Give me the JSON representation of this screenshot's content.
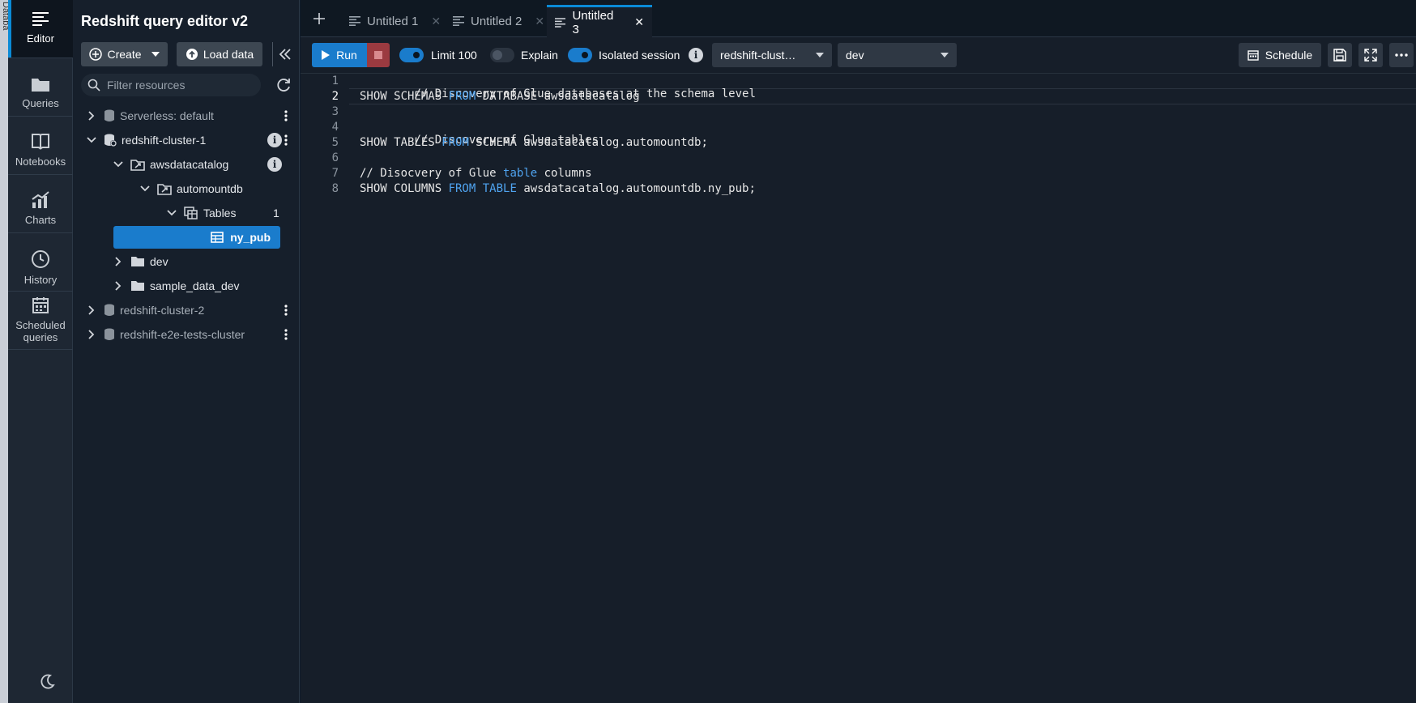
{
  "edge": {
    "label": "Databa"
  },
  "rail": {
    "items": [
      {
        "label": "Editor",
        "icon": "editor-icon"
      },
      {
        "label": "Queries",
        "icon": "folder-icon"
      },
      {
        "label": "Notebooks",
        "icon": "book-icon"
      },
      {
        "label": "Charts",
        "icon": "chart-icon"
      },
      {
        "label": "History",
        "icon": "clock-icon"
      },
      {
        "label_line1": "Scheduled",
        "label_line2": "queries",
        "icon": "calendar-icon"
      }
    ]
  },
  "panel": {
    "title": "Redshift query editor v2",
    "create_label": "Create",
    "load_label": "Load data",
    "filter_placeholder": "Filter resources",
    "tree": {
      "serverless": "Serverless: default",
      "cluster1": "redshift-cluster-1",
      "awsdatacatalog": "awsdatacatalog",
      "automountdb": "automountdb",
      "tables": "Tables",
      "tables_count": "1",
      "ny_pub": "ny_pub",
      "dev": "dev",
      "sample_data_dev": "sample_data_dev",
      "cluster2": "redshift-cluster-2",
      "e2e": "redshift-e2e-tests-cluster"
    }
  },
  "tabs": [
    {
      "label": "Untitled 1",
      "active": false
    },
    {
      "label": "Untitled 2",
      "active": false
    },
    {
      "label": "Untitled 3",
      "active": true
    }
  ],
  "toolbar": {
    "run_label": "Run",
    "limit_label": "Limit 100",
    "limit_on": true,
    "explain_label": "Explain",
    "explain_on": false,
    "isolated_label": "Isolated session",
    "isolated_on": true,
    "cluster_select": "redshift-clust…",
    "db_select": "dev",
    "schedule_label": "Schedule"
  },
  "editor": {
    "current_line": 2,
    "lines": [
      {
        "n": "1",
        "comment": "// Discovery of Glue databases at the schema level"
      },
      {
        "n": "2",
        "a": "SHOW SCHEMAS ",
        "k": "FROM",
        "b": " DATABASE awsdatacatalog"
      },
      {
        "n": "3"
      },
      {
        "n": "4",
        "comment": "// Discovery of Glue tables"
      },
      {
        "n": "5",
        "a": "SHOW TABLES ",
        "k": "FROM",
        "b": " SCHEMA awsdatacatalog.automountdb;"
      },
      {
        "n": "6"
      },
      {
        "n": "7",
        "comment_pre": "// Disocvery of Glue ",
        "k": "table",
        "comment_post": " columns"
      },
      {
        "n": "8",
        "a": "SHOW COLUMNS ",
        "k": "FROM",
        "k2": "TABLE",
        "b": " awsdatacatalog.automountdb.ny_pub;"
      }
    ]
  },
  "colors": {
    "accent": "#1a7ccc",
    "keyword": "#4fa3ef",
    "stop": "#9b3a40"
  }
}
